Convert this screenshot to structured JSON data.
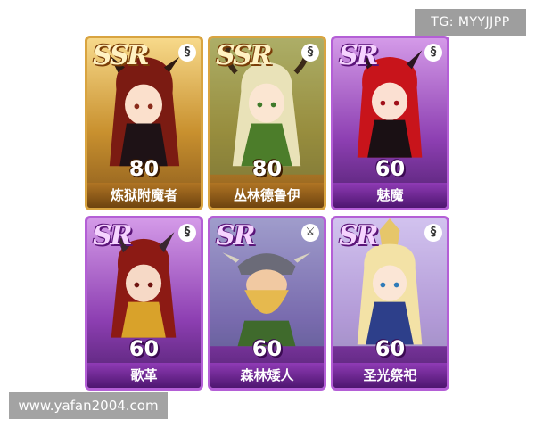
{
  "tg_label": "TG: MYYJJPP",
  "site_label": "www.yafan2004.com",
  "cards": [
    {
      "rarity": "SSR",
      "level": "80",
      "name": "炼狱附魔者",
      "type_icon": "§"
    },
    {
      "rarity": "SSR",
      "level": "80",
      "name": "丛林德鲁伊",
      "type_icon": "§"
    },
    {
      "rarity": "SR",
      "level": "60",
      "name": "魅魔",
      "type_icon": "§"
    },
    {
      "rarity": "SR",
      "level": "60",
      "name": "歌革",
      "type_icon": "§"
    },
    {
      "rarity": "SR",
      "level": "60",
      "name": "森林矮人",
      "type_icon": "⚔"
    },
    {
      "rarity": "SR",
      "level": "60",
      "name": "圣光祭祀",
      "type_icon": "§"
    }
  ]
}
